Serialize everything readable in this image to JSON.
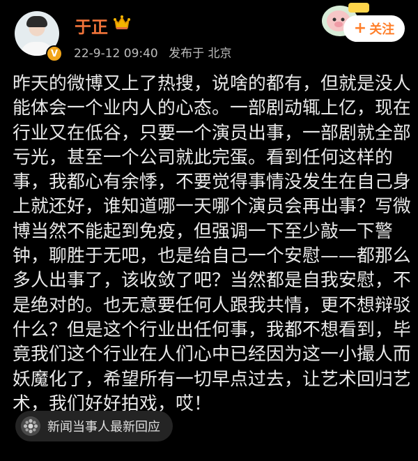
{
  "header": {
    "username": "于正",
    "verified_badge": "V",
    "timestamp": "22-9-12 09:40",
    "location": "发布于 北京",
    "follow_label": "关注",
    "colors": {
      "username": "#f1743a",
      "follow_text": "#ff7f2a",
      "badge": "#f2a51a"
    }
  },
  "post": {
    "lines": [
      "昨天的微博又上了热搜，说啥的都有，但就是没人",
      "能体会一个业内人的心态。一部剧动辄上亿，现在",
      "行业又在低谷，只要一个演员出事，一部剧就全部",
      "亏光，甚至一个公司就此完蛋。看到任何这样的",
      "事，我都心有余悸，不要觉得事情没发生在自己身",
      "上就还好，谁知道哪一天哪个演员会再出事？写微",
      "博当然不能起到免疫，但强调一下至少敲一下警",
      "钟，聊胜于无吧，也是给自己一个安慰——都那么",
      "多人出事了，该收敛了吧？当然都是自我安慰，不",
      "是绝对的。也无意要任何人跟我共情，更不想辩驳",
      "什么？但是这个行业出任何事，我都不想看到，毕",
      "竟我们这个行业在人们心中已经因为这一小撮人而",
      "妖魔化了，希望所有一切早点过去，让艺术回归艺",
      "术，我们好好拍戏，哎！"
    ]
  },
  "topic": {
    "label": "新闻当事人最新回应",
    "icon": "topic-badge-icon"
  }
}
